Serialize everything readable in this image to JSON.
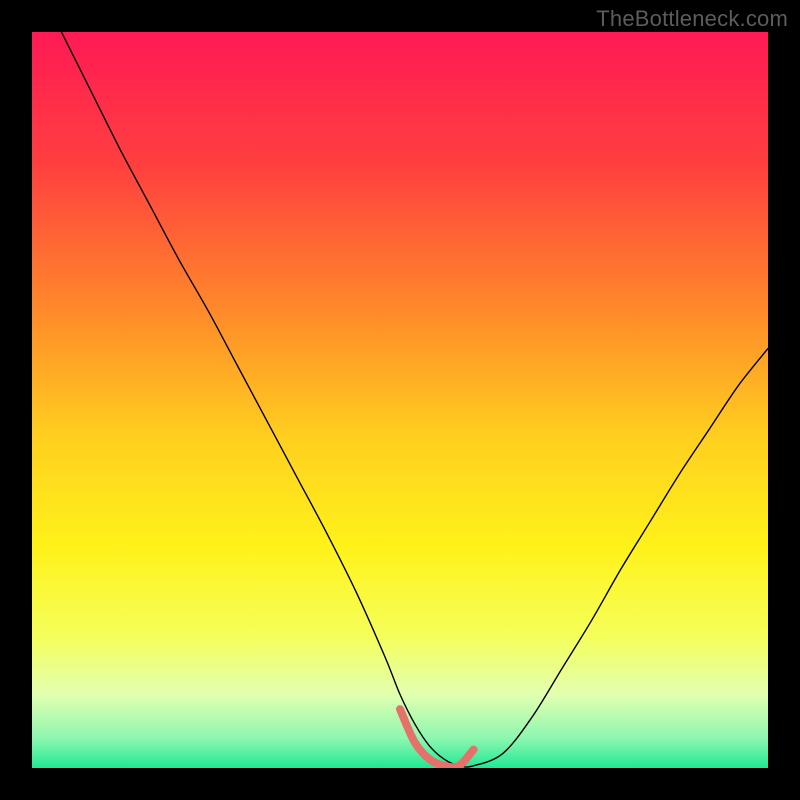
{
  "watermark": {
    "text": "TheBottleneck.com"
  },
  "chart_data": {
    "type": "line",
    "title": "",
    "xlabel": "",
    "ylabel": "",
    "xlim": [
      0,
      100
    ],
    "ylim": [
      0,
      100
    ],
    "grid": false,
    "legend": false,
    "background": {
      "type": "vertical-gradient",
      "stops": [
        {
          "pos": 0.0,
          "color": "#ff1a55"
        },
        {
          "pos": 0.18,
          "color": "#ff3f3f"
        },
        {
          "pos": 0.38,
          "color": "#ff8a2a"
        },
        {
          "pos": 0.55,
          "color": "#ffcf1f"
        },
        {
          "pos": 0.7,
          "color": "#fff21a"
        },
        {
          "pos": 0.82,
          "color": "#f5ff5a"
        },
        {
          "pos": 0.9,
          "color": "#e2ffb0"
        },
        {
          "pos": 0.96,
          "color": "#8cf7b0"
        },
        {
          "pos": 1.0,
          "color": "#1fe893"
        }
      ]
    },
    "series": [
      {
        "name": "bottleneck-curve",
        "color": "#000000",
        "stroke_width": 1.4,
        "x": [
          4,
          8,
          12,
          16,
          20,
          24,
          28,
          32,
          36,
          40,
          44,
          48,
          50,
          52,
          54,
          56,
          58,
          60,
          64,
          68,
          72,
          76,
          80,
          84,
          88,
          92,
          96,
          100
        ],
        "values": [
          100,
          92,
          84,
          76.5,
          69,
          62,
          54.5,
          47,
          39.5,
          32,
          24,
          15,
          10,
          6,
          3,
          1.2,
          0.3,
          0.3,
          2,
          7,
          13.5,
          20,
          27,
          33.5,
          40,
          46,
          52,
          57
        ]
      },
      {
        "name": "optimal-region-marker",
        "color": "#e4716a",
        "stroke_width": 8,
        "linecap": "round",
        "x": [
          50,
          52,
          54,
          56,
          58,
          60
        ],
        "values": [
          8,
          3.5,
          1.2,
          0.3,
          0.3,
          2.5
        ]
      }
    ]
  }
}
